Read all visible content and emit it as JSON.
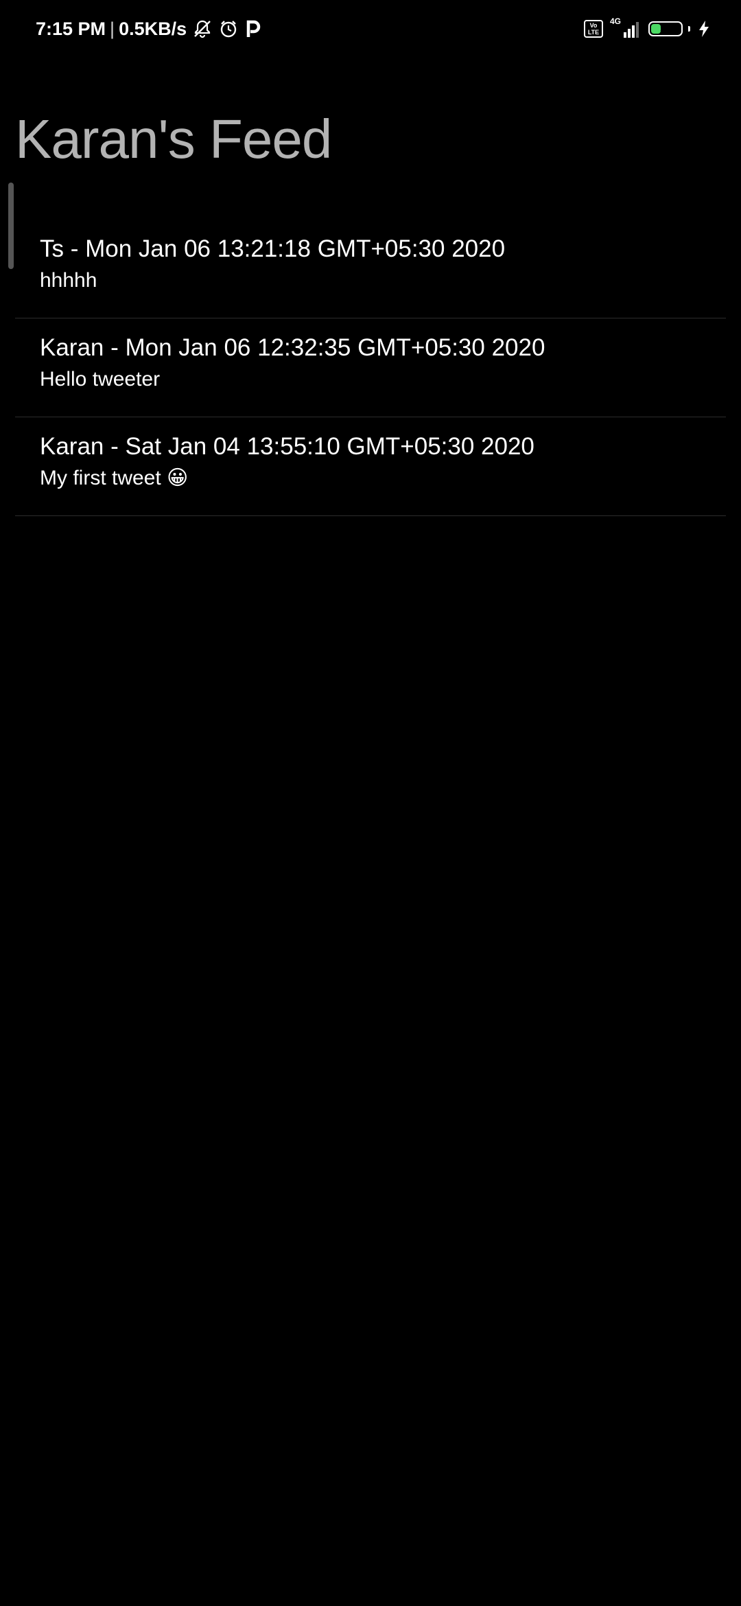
{
  "status_bar": {
    "time": "7:15 PM",
    "separator": "|",
    "net_speed": "0.5KB/s",
    "icons_left": [
      "mute-icon",
      "alarm-icon",
      "p-app-icon"
    ],
    "volte_label": "Vo LTE",
    "network_type": "4G",
    "signal_level": 3,
    "battery_percent": "39",
    "battery_level": 0.39,
    "charging_icon": "bolt-icon"
  },
  "page": {
    "title": "Karan's Feed"
  },
  "feed": [
    {
      "header": "Ts - Mon Jan 06 13:21:18 GMT+05:30 2020",
      "body": "hhhhh"
    },
    {
      "header": "Karan - Mon Jan 06 12:32:35 GMT+05:30 2020",
      "body": "Hello tweeter"
    },
    {
      "header": "Karan - Sat Jan 04 13:55:10 GMT+05:30 2020",
      "body": "My first tweet 😀"
    }
  ],
  "colors": {
    "background": "#000000",
    "title": "#b3b3b3",
    "text": "#ffffff",
    "divider": "#2c2c2c",
    "battery": "#4cd964"
  }
}
